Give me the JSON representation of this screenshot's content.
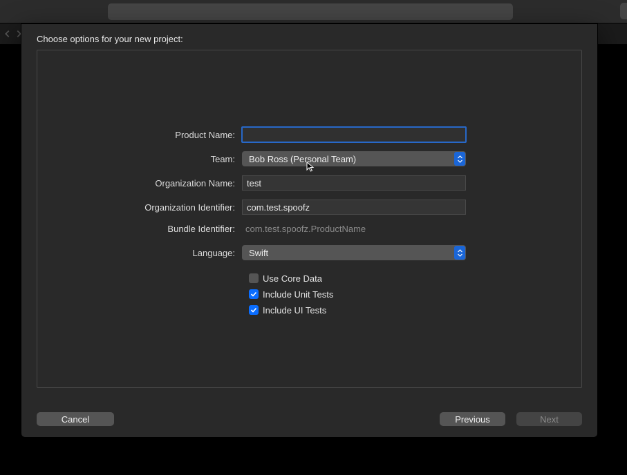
{
  "dialog": {
    "title": "Choose options for your new project:"
  },
  "form": {
    "productName": {
      "label": "Product Name:",
      "value": ""
    },
    "team": {
      "label": "Team:",
      "value": "Bob Ross (Personal Team)"
    },
    "orgName": {
      "label": "Organization Name:",
      "value": "test"
    },
    "orgIdentifier": {
      "label": "Organization Identifier:",
      "value": "com.test.spoofz"
    },
    "bundleIdentifier": {
      "label": "Bundle Identifier:",
      "value": "com.test.spoofz.ProductName"
    },
    "language": {
      "label": "Language:",
      "value": "Swift"
    },
    "useCoreData": {
      "label": "Use Core Data",
      "checked": false
    },
    "includeUnitTests": {
      "label": "Include Unit Tests",
      "checked": true
    },
    "includeUITests": {
      "label": "Include UI Tests",
      "checked": true
    }
  },
  "buttons": {
    "cancel": "Cancel",
    "previous": "Previous",
    "next": "Next"
  }
}
